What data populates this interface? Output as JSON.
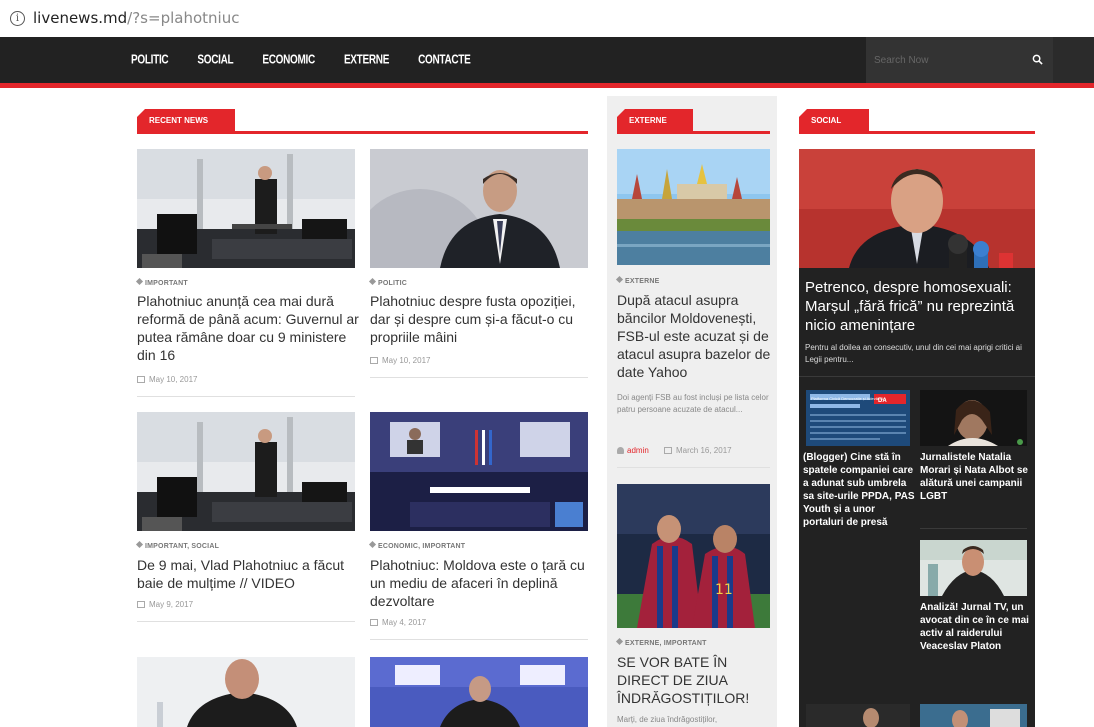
{
  "browser": {
    "host": "livenews.md",
    "path": "/?s=plahotniuc",
    "info_icon": "info-icon"
  },
  "nav": {
    "items": [
      "POLITIC",
      "SOCIAL",
      "ECONOMIC",
      "EXTERNE",
      "CONTACTE"
    ],
    "search_placeholder": "Search Now",
    "search_icon": "search-icon"
  },
  "sections": {
    "recent": "RECENT NEWS",
    "externe": "EXTERNE",
    "social": "SOCIAL"
  },
  "recent": [
    {
      "category": "IMPORTANT",
      "title": "Plahotniuc anunță cea mai dură reformă de până acum: Guvernul ar putea rămâne doar cu 9 ministere din 16",
      "date": "May 10, 2017"
    },
    {
      "category": "POLITIC",
      "title": "Plahotniuc despre fusta opoziției, dar și despre cum și-a făcut-o cu propriile mâini",
      "date": "May 10, 2017"
    },
    {
      "category": "IMPORTANT, SOCIAL",
      "title": "De 9 mai, Vlad Plahotniuc a făcut baie de mulțime // VIDEO",
      "date": "May 9, 2017"
    },
    {
      "category": "ECONOMIC, IMPORTANT",
      "title": "Plahotniuc: Moldova este o țară cu un mediu de afaceri în deplină dezvoltare",
      "date": "May 4, 2017"
    }
  ],
  "externe": [
    {
      "category": "EXTERNE",
      "title": "După atacul asupra băncilor Moldovenești, FSB-ul este acuzat și de atacul asupra bazelor de date Yahoo",
      "excerpt": "Doi agenți FSB au fost incluși pe lista celor patru persoane acuzate de atacul...",
      "author": "admin",
      "date": "March 16, 2017"
    },
    {
      "category": "EXTERNE, IMPORTANT",
      "title": "SE VOR BATE ÎN DIRECT DE ZIUA ÎNDRĂGOSTIȚILOR!",
      "excerpt": "Marți, de ziua îndrăgostiților,"
    }
  ],
  "social": {
    "main_title": "Petrenco, despre homosexuali: Marșul „fără frică” nu reprezintă nicio amenințare",
    "main_excerpt": "Pentru al doilea an consecutiv, unul din cei mai aprigi critici ai Legii pentru...",
    "thumb_text": [
      "Platforma Civică Democratie și Adevăr DA",
      "DA"
    ],
    "items": [
      "(Blogger) Cine stă în spatele companiei care a adunat sub umbrela sa site-urile PPDA, PAS Youth și a unor portaluri de presă",
      "Jurnalistele Natalia Morari și Nata Albot se alătură unei campanii LGBT",
      "Analiză! Jurnal TV, un avocat din ce în ce mai activ al raiderului Veaceslav Platon"
    ]
  },
  "colors": {
    "accent": "#e3262b",
    "nav_bg": "#222222",
    "social_bg": "#222222"
  }
}
